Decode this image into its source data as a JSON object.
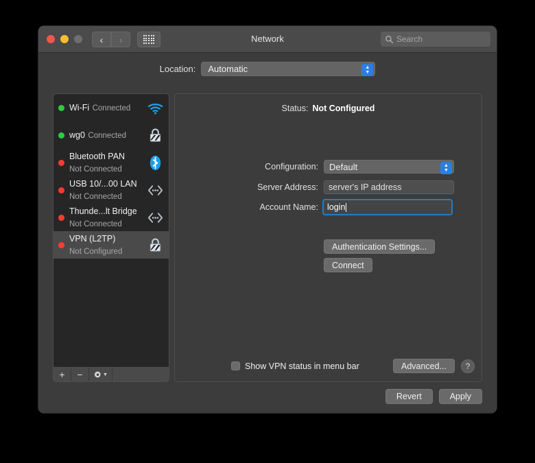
{
  "window": {
    "title": "Network",
    "traffic_lights": [
      "close-red",
      "minimize-yellow",
      "zoom-gray"
    ],
    "nav_back": "‹",
    "nav_forward": "›"
  },
  "search": {
    "placeholder": "Search",
    "value": ""
  },
  "location": {
    "label": "Location:",
    "value": "Automatic"
  },
  "sidebar": {
    "services": [
      {
        "name": "Wi-Fi",
        "state": "Connected",
        "status": "green",
        "icon": "wifi-icon"
      },
      {
        "name": "wg0",
        "state": "Connected",
        "status": "green",
        "icon": "lock-icon"
      },
      {
        "name": "Bluetooth PAN",
        "state": "Not Connected",
        "status": "red",
        "icon": "bluetooth-icon"
      },
      {
        "name": "USB 10/...00 LAN",
        "state": "Not Connected",
        "status": "red",
        "icon": "ethernet-icon"
      },
      {
        "name": "Thunde...lt Bridge",
        "state": "Not Connected",
        "status": "red",
        "icon": "ethernet-icon"
      },
      {
        "name": "VPN (L2TP)",
        "state": "Not Configured",
        "status": "red",
        "icon": "lock-icon",
        "selected": true
      }
    ],
    "toolbar": {
      "add": "+",
      "remove": "−",
      "actions": "gear-icon"
    }
  },
  "detail": {
    "status_label": "Status:",
    "status_value": "Not Configured",
    "configuration_label": "Configuration:",
    "configuration_value": "Default",
    "server_address_label": "Server Address:",
    "server_address_value": "server's IP address",
    "account_name_label": "Account Name:",
    "account_name_value": "login",
    "auth_settings_button": "Authentication Settings...",
    "connect_button": "Connect",
    "show_status_checkbox": "Show VPN status in menu bar",
    "show_status_checked": false,
    "advanced_button": "Advanced...",
    "help_button": "?"
  },
  "footer": {
    "revert": "Revert",
    "apply": "Apply"
  },
  "colors": {
    "accent_blue": "#2b7fe0",
    "focus_ring": "#1f7fc4",
    "status_connected": "#2ecc40",
    "status_disconnected": "#ff3b30",
    "window_bg": "#3c3c3c",
    "list_bg": "#262626",
    "selected_row": "#4a4a4a"
  }
}
